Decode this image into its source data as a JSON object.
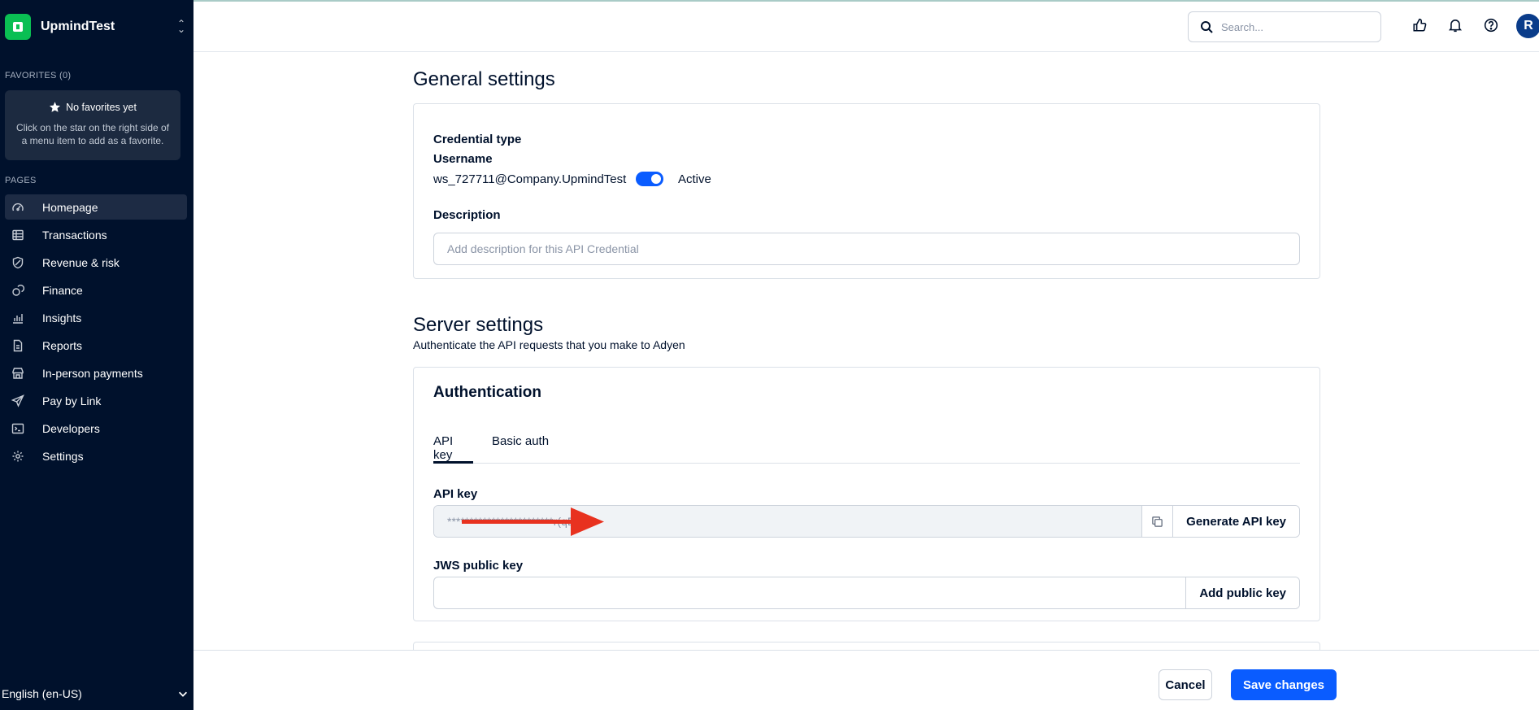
{
  "sidebar": {
    "account_name": "UpmindTest",
    "favorites_title": "FAVORITES (0)",
    "favorites_empty_title": "No favorites yet",
    "favorites_empty_desc": "Click on the star on the right side of a menu item to add as a favorite.",
    "pages_title": "PAGES",
    "items": [
      {
        "label": "Homepage",
        "icon": "gauge-icon",
        "active": true
      },
      {
        "label": "Transactions",
        "icon": "table-icon"
      },
      {
        "label": "Revenue & risk",
        "icon": "shield-icon"
      },
      {
        "label": "Finance",
        "icon": "coins-icon"
      },
      {
        "label": "Insights",
        "icon": "bar-chart-icon"
      },
      {
        "label": "Reports",
        "icon": "document-icon"
      },
      {
        "label": "In-person payments",
        "icon": "store-icon"
      },
      {
        "label": "Pay by Link",
        "icon": "paper-plane-icon"
      },
      {
        "label": "Developers",
        "icon": "terminal-icon"
      },
      {
        "label": "Settings",
        "icon": "gear-icon"
      }
    ],
    "language": "English (en-US)"
  },
  "topbar": {
    "search_placeholder": "Search...",
    "avatar_initial": "R"
  },
  "general": {
    "heading": "General settings",
    "credential_type_label": "Credential type",
    "username_label": "Username",
    "username_value": "ws_727711@Company.UpmindTest",
    "status": "Active",
    "description_label": "Description",
    "description_placeholder": "Add description for this API Credential"
  },
  "server": {
    "heading": "Server settings",
    "subtitle": "Authenticate the API requests that you make to Adyen",
    "auth_title": "Authentication",
    "tabs": [
      {
        "label": "API key",
        "active": true
      },
      {
        "label": "Basic auth",
        "active": false
      }
    ],
    "api_key_label": "API key",
    "api_key_value": "************************r(qEn",
    "generate_button": "Generate API key",
    "jws_label": "JWS public key",
    "jws_value": "",
    "add_key_button": "Add public key"
  },
  "footer": {
    "cancel": "Cancel",
    "save": "Save changes"
  },
  "colors": {
    "sidebar_bg": "#00112c",
    "accent": "#0a5cff",
    "brand_green": "#0abf53",
    "annotation_arrow": "#e8321f"
  }
}
